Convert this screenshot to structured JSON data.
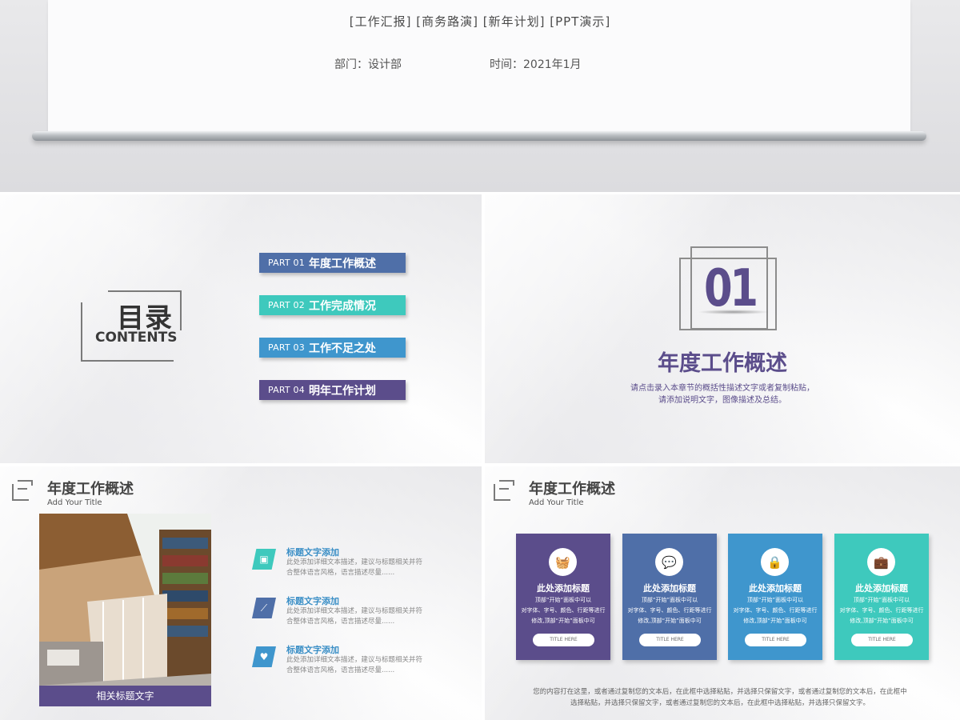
{
  "top": {
    "tags": "[工作汇报] [商务路演] [新年计划] [PPT演示]",
    "department": "部门：设计部",
    "time": "时间：2021年1月"
  },
  "toc": {
    "heading": "目录",
    "heading_en": "CONTENTS",
    "items": [
      {
        "num": "PART 01",
        "label": "年度工作概述",
        "color": "#4f6fa8"
      },
      {
        "num": "PART 02",
        "label": "工作完成情况",
        "color": "#3ec9bd"
      },
      {
        "num": "PART 03",
        "label": "工作不足之处",
        "color": "#3f96cd"
      },
      {
        "num": "PART 04",
        "label": "明年工作计划",
        "color": "#5b4d8b"
      }
    ]
  },
  "part": {
    "number": "01",
    "title": "年度工作概述",
    "desc_line1": "请点击录入本章节的概括性描述文字或者复制粘贴，",
    "desc_line2": "请添加说明文字，图像描述及总结。"
  },
  "photo_slide": {
    "title": "年度工作概述",
    "subtitle": "Add Your Title",
    "caption": "相关标题文字",
    "features": [
      {
        "icon": "picture-icon",
        "color": "#3ec9bd",
        "title": "标题文字添加",
        "line1": "此处添加详细文本描述，建议与标题相关并符",
        "line2": "合整体语言风格，语言描述尽量......"
      },
      {
        "icon": "chart-icon",
        "color": "#4f6fa8",
        "title": "标题文字添加",
        "line1": "此处添加详细文本描述，建议与标题相关并符",
        "line2": "合整体语言风格，语言描述尽量......"
      },
      {
        "icon": "heart-icon",
        "color": "#3f96cd",
        "title": "标题文字添加",
        "line1": "此处添加详细文本描述，建议与标题相关并符",
        "line2": "合整体语言风格，语言描述尽量......"
      }
    ]
  },
  "cards_slide": {
    "title": "年度工作概述",
    "subtitle": "Add Your Title",
    "cards": [
      {
        "icon": "basket-icon",
        "glyph": "🧺",
        "color": "#5b4d8b",
        "title": "此处添加标题",
        "l1": "顶部“开始”面板中可以",
        "l2": "对字体、字号、颜色、行距等进行",
        "l3": "修改,顶部“开始”面板中可",
        "button": "TITLE HERE"
      },
      {
        "icon": "chat-icon",
        "glyph": "💬",
        "color": "#4f6fa8",
        "title": "此处添加标题",
        "l1": "顶部“开始”面板中可以",
        "l2": "对字体、字号、颜色、行距等进行",
        "l3": "修改,顶部“开始”面板中可",
        "button": "TITLE HERE"
      },
      {
        "icon": "lock-icon",
        "glyph": "🔒",
        "color": "#3f96cd",
        "title": "此处添加标题",
        "l1": "顶部“开始”面板中可以",
        "l2": "对字体、字号、颜色、行距等进行",
        "l3": "修改,顶部“开始”面板中可",
        "button": "TITLE HERE"
      },
      {
        "icon": "briefcase-icon",
        "glyph": "💼",
        "color": "#3ec9bd",
        "title": "此处添加标题",
        "l1": "顶部“开始”面板中可以",
        "l2": "对字体、字号、颜色、行距等进行",
        "l3": "修改,顶部“开始”面板中可",
        "button": "TITLE HERE"
      }
    ],
    "footer_line1": "您的内容打在这里，或者通过复制您的文本后，在此框中选择粘贴，并选择只保留文字，或者通过复制您的文本后，在此框中",
    "footer_line2": "选择粘贴，并选择只保留文字，或者通过复制您的文本后，在此框中选择粘贴，并选择只保留文字。"
  }
}
